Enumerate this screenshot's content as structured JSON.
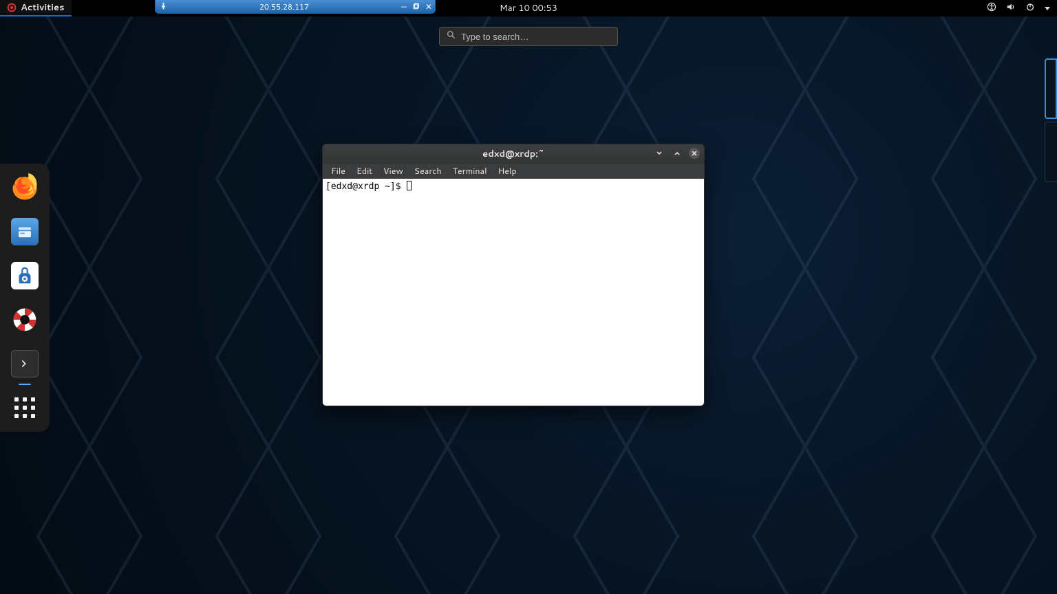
{
  "top_panel": {
    "activities_label": "Activities",
    "clock": "Mar 10  00:53"
  },
  "rdp_bar": {
    "address": "20.55.28.117"
  },
  "search": {
    "placeholder": "Type to search…"
  },
  "dash": {
    "apps": [
      {
        "name": "firefox"
      },
      {
        "name": "files"
      },
      {
        "name": "software"
      },
      {
        "name": "help"
      },
      {
        "name": "terminal",
        "running": true
      }
    ]
  },
  "workspaces": {
    "count": 2,
    "active_index": 0
  },
  "terminal": {
    "title": "edxd@xrdp:~",
    "menu": {
      "file": "File",
      "edit": "Edit",
      "view": "View",
      "search": "Search",
      "terminal": "Terminal",
      "help": "Help"
    },
    "prompt": "[edxd@xrdp ~]$ "
  }
}
